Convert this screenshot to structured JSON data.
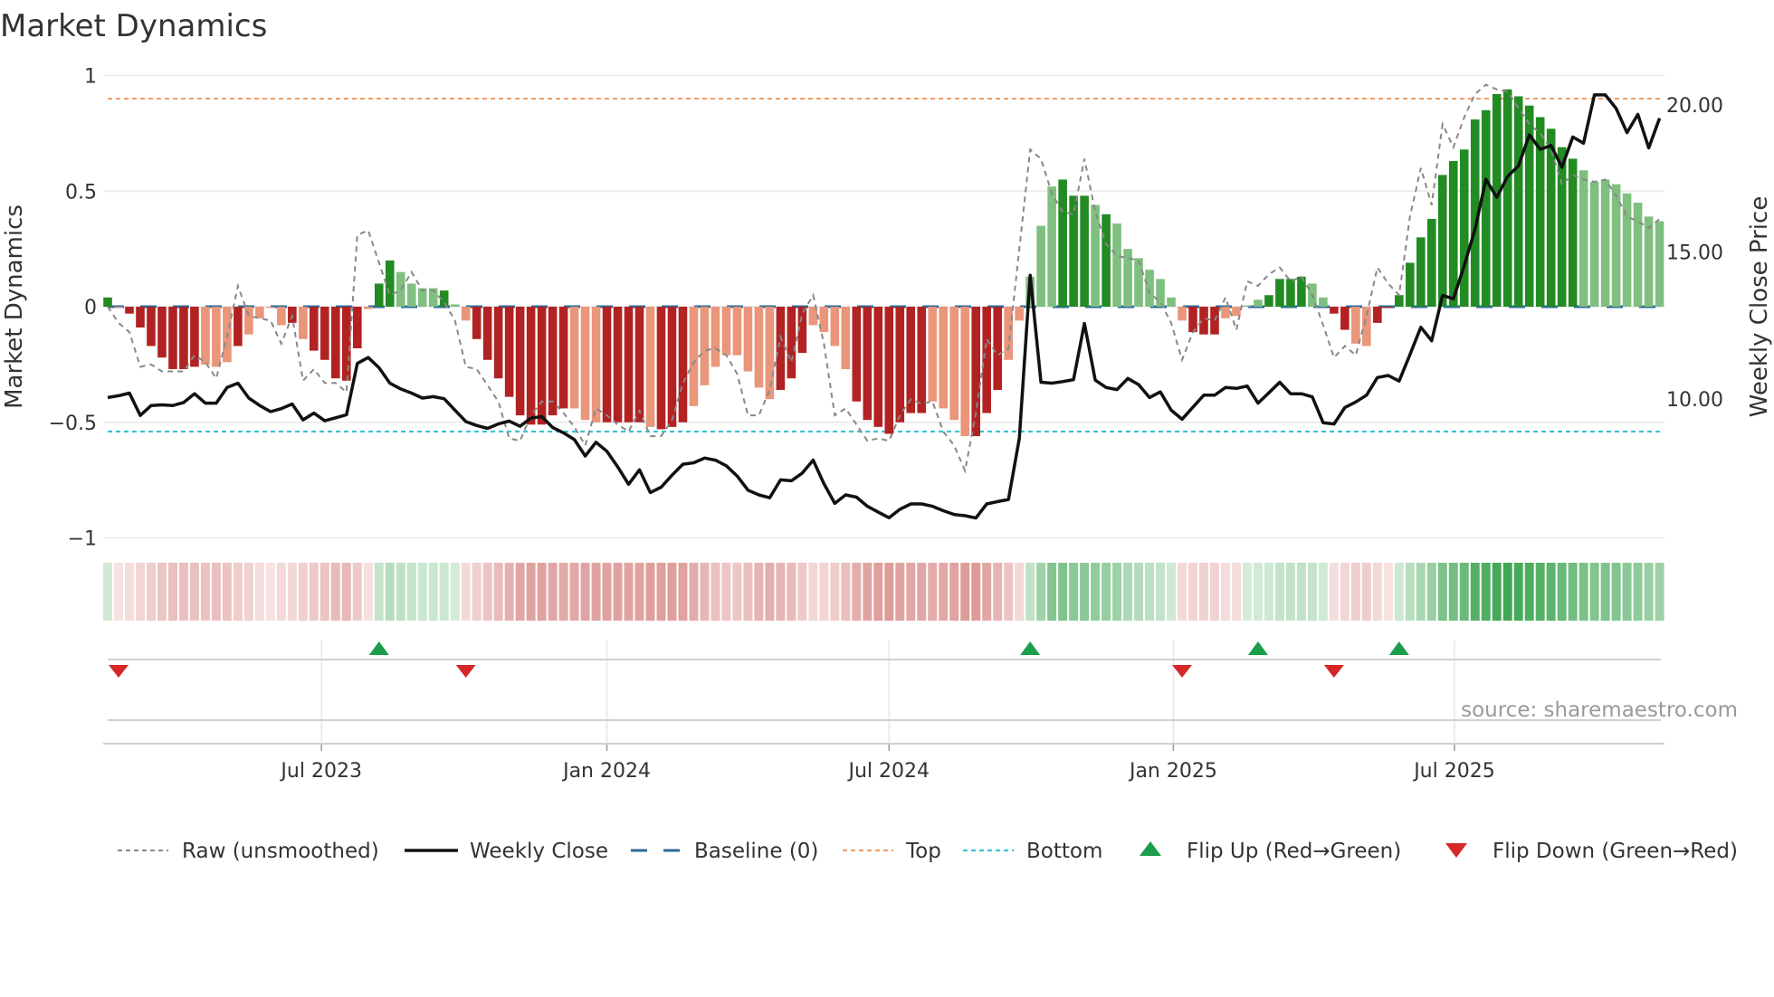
{
  "chart_data": {
    "type": "bar",
    "title": "Market Dynamics",
    "ylabel_left": "Market Dynamics",
    "ylabel_right": "Weekly Close Price",
    "ylim_left": [
      -1,
      1
    ],
    "ylim_right": [
      5.26,
      20.98
    ],
    "yticks_left": [
      {
        "value": 1,
        "label": "1"
      },
      {
        "value": 0.5,
        "label": "0.5"
      },
      {
        "value": 0,
        "label": "0"
      },
      {
        "value": -0.5,
        "label": "−0.5"
      },
      {
        "value": -1,
        "label": "−1"
      }
    ],
    "yticks_right": [
      {
        "value": 20,
        "label": "20.00"
      },
      {
        "value": 15,
        "label": "15.00"
      },
      {
        "value": 10,
        "label": "10.00"
      }
    ],
    "x_unit": "week index",
    "xticks": [
      {
        "week_index": 19.7,
        "label": "Jul 2023"
      },
      {
        "week_index": 46.0,
        "label": "Jan 2024"
      },
      {
        "week_index": 72.0,
        "label": "Jul 2024"
      },
      {
        "week_index": 98.2,
        "label": "Jan 2025"
      },
      {
        "week_index": 124.1,
        "label": "Jul 2025"
      }
    ],
    "levels": {
      "baseline": 0,
      "top": 0.9,
      "bottom": -0.54
    },
    "grid": true,
    "legend_position": "bottom",
    "colors": {
      "strong_up": "#228b22",
      "weak_up": "#7fbf7f",
      "strong_down": "#b22222",
      "weak_down": "#e9967a",
      "raw": "#888888",
      "close": "#111111",
      "baseline": "#2b6a9b",
      "top": "#f0a06a",
      "bottom": "#3cc3d4",
      "flip_up": "#1a9e4a",
      "flip_down": "#d62728"
    },
    "smoothed": [
      0.04,
      -0.005,
      -0.03,
      -0.09,
      -0.17,
      -0.22,
      -0.27,
      -0.27,
      -0.26,
      -0.25,
      -0.26,
      -0.24,
      -0.17,
      -0.12,
      -0.05,
      -0.005,
      -0.08,
      -0.07,
      -0.14,
      -0.19,
      -0.23,
      -0.31,
      -0.32,
      -0.18,
      -0.01,
      0.1,
      0.2,
      0.15,
      0.1,
      0.08,
      0.08,
      0.07,
      0.01,
      -0.06,
      -0.14,
      -0.23,
      -0.31,
      -0.39,
      -0.47,
      -0.51,
      -0.51,
      -0.47,
      -0.44,
      -0.44,
      -0.49,
      -0.5,
      -0.5,
      -0.5,
      -0.5,
      -0.5,
      -0.52,
      -0.53,
      -0.52,
      -0.5,
      -0.43,
      -0.34,
      -0.26,
      -0.21,
      -0.21,
      -0.28,
      -0.35,
      -0.4,
      -0.36,
      -0.31,
      -0.2,
      -0.08,
      -0.11,
      -0.17,
      -0.27,
      -0.41,
      -0.49,
      -0.52,
      -0.55,
      -0.5,
      -0.46,
      -0.46,
      -0.41,
      -0.44,
      -0.49,
      -0.56,
      -0.56,
      -0.46,
      -0.36,
      -0.23,
      -0.06,
      0.13,
      0.35,
      0.52,
      0.55,
      0.48,
      0.48,
      0.44,
      0.4,
      0.36,
      0.25,
      0.21,
      0.16,
      0.12,
      0.04,
      -0.06,
      -0.11,
      -0.12,
      -0.12,
      -0.05,
      -0.04,
      0.005,
      0.03,
      0.05,
      0.12,
      0.12,
      0.13,
      0.1,
      0.04,
      -0.03,
      -0.1,
      -0.16,
      -0.17,
      -0.07,
      -0.005,
      0.05,
      0.19,
      0.3,
      0.38,
      0.57,
      0.63,
      0.68,
      0.81,
      0.85,
      0.92,
      0.94,
      0.91,
      0.87,
      0.82,
      0.77,
      0.69,
      0.64,
      0.59,
      0.54,
      0.55,
      0.53,
      0.49,
      0.45,
      0.39,
      0.37
    ],
    "strength": "dldddddddllldlllldldddddlddlllldlldddddddddlllddddldddlllllllldddlllldddddddlllldddllllldddldllllllldddllllddddllddlldddddddddddddddddddlllllllldllllll",
    "raw": [
      0.0,
      -0.07,
      -0.11,
      -0.26,
      -0.25,
      -0.28,
      -0.28,
      -0.28,
      -0.21,
      -0.24,
      -0.31,
      -0.13,
      0.09,
      -0.04,
      -0.05,
      -0.06,
      -0.16,
      -0.04,
      -0.32,
      -0.27,
      -0.33,
      -0.33,
      -0.37,
      0.31,
      0.33,
      0.19,
      0.05,
      0.07,
      0.15,
      0.07,
      0.07,
      0.02,
      -0.06,
      -0.26,
      -0.27,
      -0.34,
      -0.41,
      -0.57,
      -0.58,
      -0.47,
      -0.41,
      -0.41,
      -0.46,
      -0.52,
      -0.6,
      -0.44,
      -0.47,
      -0.51,
      -0.54,
      -0.45,
      -0.56,
      -0.56,
      -0.49,
      -0.33,
      -0.24,
      -0.19,
      -0.18,
      -0.21,
      -0.29,
      -0.47,
      -0.47,
      -0.36,
      -0.13,
      -0.24,
      -0.03,
      0.05,
      -0.16,
      -0.47,
      -0.44,
      -0.51,
      -0.58,
      -0.57,
      -0.58,
      -0.47,
      -0.4,
      -0.42,
      -0.41,
      -0.54,
      -0.6,
      -0.71,
      -0.46,
      -0.14,
      -0.21,
      -0.18,
      0.25,
      0.68,
      0.64,
      0.49,
      0.41,
      0.4,
      0.64,
      0.41,
      0.27,
      0.22,
      0.21,
      0.2,
      0.06,
      0.02,
      -0.07,
      -0.23,
      -0.11,
      -0.05,
      -0.06,
      0.04,
      -0.1,
      0.11,
      0.09,
      0.14,
      0.17,
      0.11,
      0.13,
      0.05,
      -0.08,
      -0.22,
      -0.17,
      -0.21,
      -0.04,
      0.17,
      0.1,
      0.05,
      0.39,
      0.6,
      0.44,
      0.79,
      0.69,
      0.82,
      0.92,
      0.96,
      0.94,
      0.93,
      0.86,
      0.79,
      0.75,
      0.68,
      0.53,
      0.57,
      0.55,
      0.54,
      0.55,
      0.48,
      0.39,
      0.37,
      0.34,
      0.38
    ],
    "close": [
      10.05,
      10.11,
      10.2,
      9.44,
      9.78,
      9.8,
      9.78,
      9.88,
      10.18,
      9.86,
      9.86,
      10.39,
      10.54,
      10.03,
      9.78,
      9.57,
      9.67,
      9.83,
      9.29,
      9.52,
      9.26,
      9.36,
      9.46,
      11.21,
      11.41,
      11.06,
      10.54,
      10.34,
      10.2,
      10.03,
      10.08,
      10.01,
      9.62,
      9.23,
      9.1,
      9.0,
      9.15,
      9.25,
      9.07,
      9.35,
      9.4,
      9.03,
      8.85,
      8.62,
      8.06,
      8.53,
      8.22,
      7.69,
      7.1,
      7.59,
      6.82,
      7.0,
      7.41,
      7.78,
      7.83,
      7.99,
      7.92,
      7.73,
      7.38,
      6.9,
      6.74,
      6.64,
      7.25,
      7.22,
      7.48,
      7.92,
      7.12,
      6.45,
      6.74,
      6.66,
      6.35,
      6.15,
      5.96,
      6.25,
      6.43,
      6.43,
      6.35,
      6.2,
      6.07,
      6.03,
      5.95,
      6.43,
      6.51,
      6.58,
      8.66,
      14.21,
      10.57,
      10.54,
      10.59,
      10.66,
      12.57,
      10.64,
      10.39,
      10.32,
      10.7,
      10.49,
      10.05,
      10.24,
      9.62,
      9.31,
      9.72,
      10.13,
      10.13,
      10.39,
      10.36,
      10.44,
      9.86,
      10.21,
      10.57,
      10.18,
      10.18,
      10.07,
      9.19,
      9.15,
      9.71,
      9.9,
      10.13,
      10.73,
      10.8,
      10.61,
      11.51,
      12.44,
      11.98,
      13.52,
      13.41,
      14.54,
      15.78,
      17.47,
      16.86,
      17.57,
      17.93,
      18.98,
      18.49,
      18.62,
      17.88,
      18.91,
      18.7,
      20.34,
      20.34,
      19.88,
      19.06,
      19.68,
      18.54,
      19.55
    ],
    "flip_up_weeks": [
      25,
      85,
      106,
      119
    ],
    "flip_down_weeks": [
      1,
      33,
      99,
      113
    ],
    "legend": [
      {
        "key": "raw",
        "label": "Raw (unsmoothed)"
      },
      {
        "key": "close",
        "label": "Weekly Close"
      },
      {
        "key": "baseline",
        "label": "Baseline (0)"
      },
      {
        "key": "top",
        "label": "Top"
      },
      {
        "key": "bottom",
        "label": "Bottom"
      },
      {
        "key": "flip_up",
        "label": "Flip Up (Red→Green)"
      },
      {
        "key": "flip_down",
        "label": "Flip Down (Green→Red)"
      }
    ],
    "source": "source: sharemaestro.com"
  }
}
